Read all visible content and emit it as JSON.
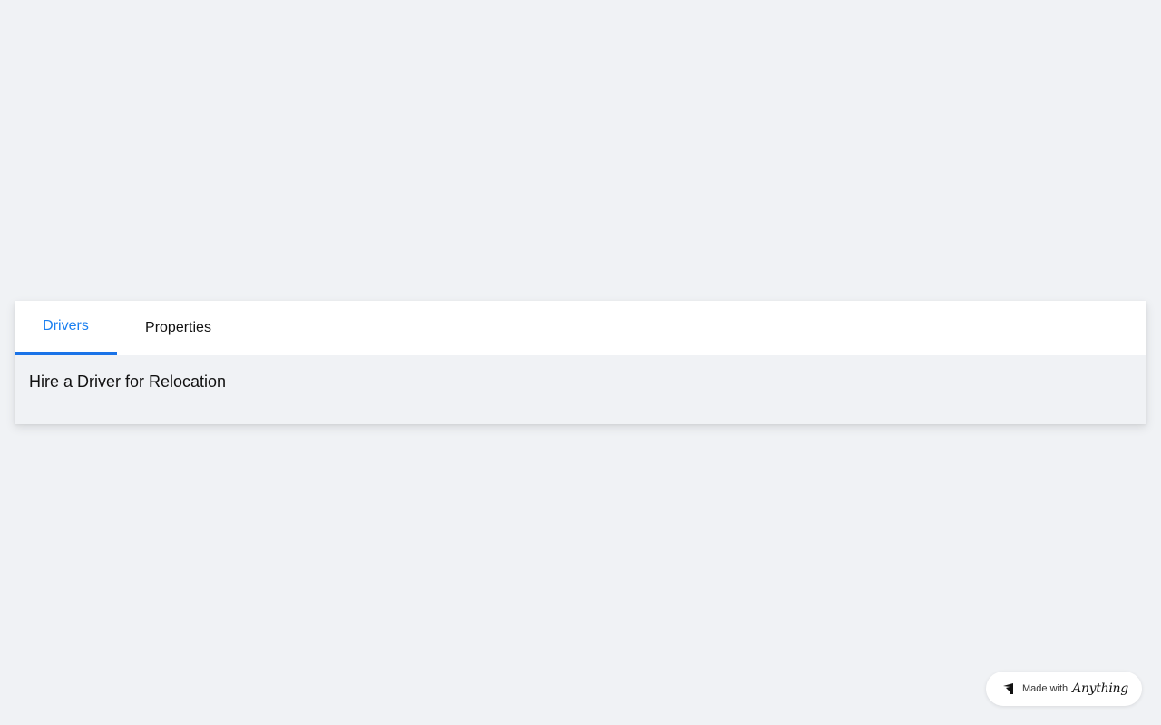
{
  "tabs": [
    {
      "label": "Drivers",
      "active": true
    },
    {
      "label": "Properties",
      "active": false
    }
  ],
  "content": {
    "title": "Hire a Driver for Relocation"
  },
  "badge": {
    "prefix": "Made with",
    "brand": "Anything",
    "icon": "anything-logo-icon"
  },
  "colors": {
    "accent": "#1a73e8",
    "background": "#f0f2f5"
  }
}
